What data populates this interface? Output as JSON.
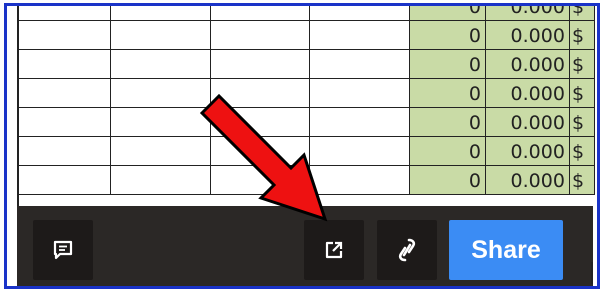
{
  "spreadsheet": {
    "rows": [
      {
        "qty": "0",
        "price": "0.000",
        "currency": "$"
      },
      {
        "qty": "0",
        "price": "0.000",
        "currency": "$"
      },
      {
        "qty": "0",
        "price": "0.000",
        "currency": "$"
      },
      {
        "qty": "0",
        "price": "0.000",
        "currency": "$"
      },
      {
        "qty": "0",
        "price": "0.000",
        "currency": "$"
      },
      {
        "qty": "0",
        "price": "0.000",
        "currency": "$"
      },
      {
        "qty": "0",
        "price": "0.000",
        "currency": "$"
      }
    ],
    "highlight_color": "#c9dba6"
  },
  "toolbar": {
    "comment_icon": "comment-icon",
    "open_external_icon": "open-external-icon",
    "link_icon": "link-icon",
    "share_label": "Share",
    "share_color": "#3b8cf4"
  },
  "annotation": {
    "arrow_color": "#ee1111",
    "arrow_icon": "red-pointer-arrow"
  }
}
